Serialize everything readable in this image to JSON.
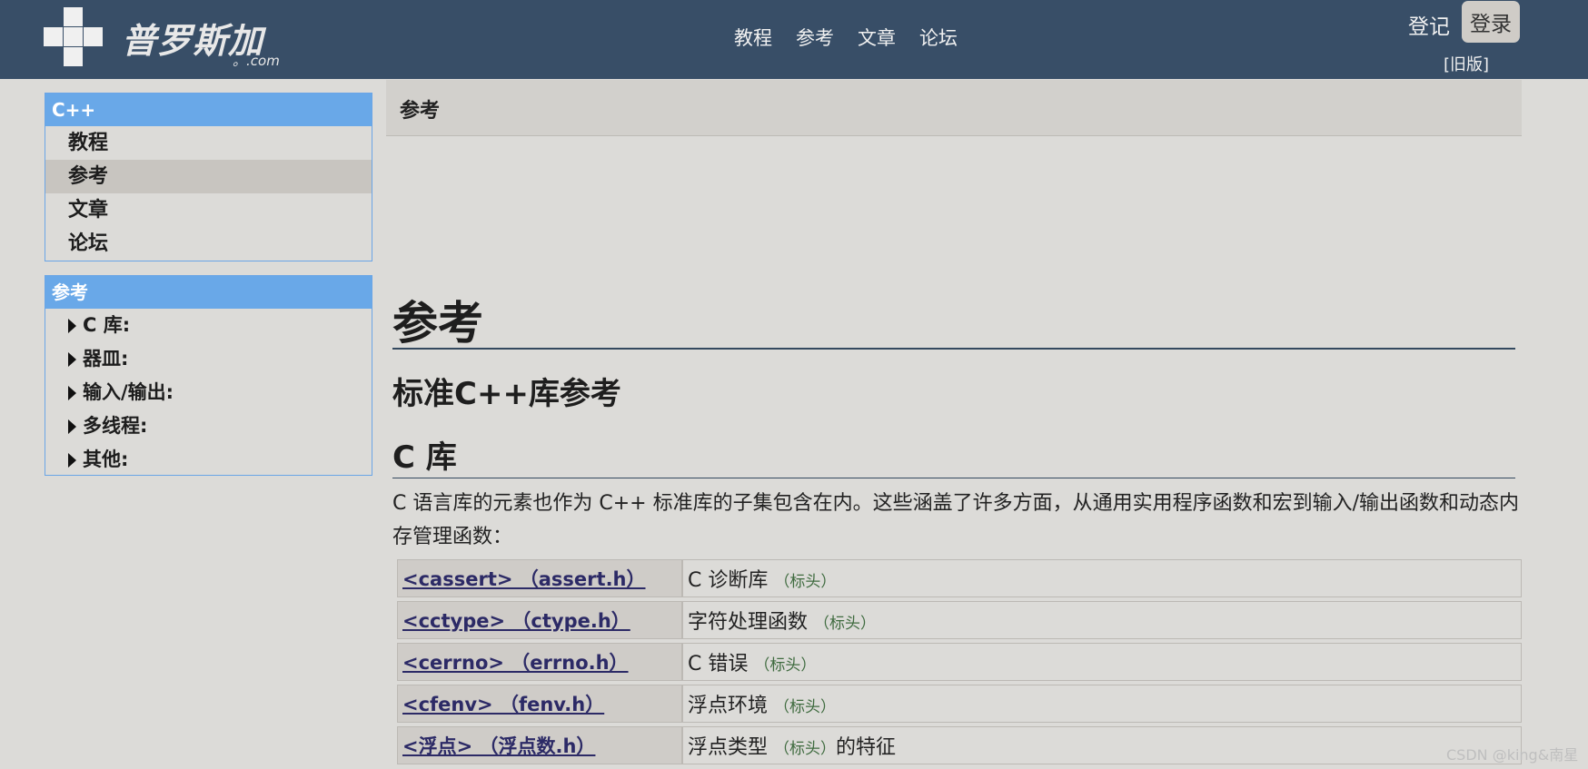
{
  "header": {
    "logo_text": "普罗斯加",
    "logo_domain": "。.com",
    "nav": [
      "教程",
      "参考",
      "文章",
      "论坛"
    ],
    "signup_label": "登记",
    "login_label": "登录",
    "old_version_label": "[旧版]"
  },
  "sidebar": {
    "main_box": {
      "title": "C++",
      "items": [
        "教程",
        "参考",
        "文章",
        "论坛"
      ],
      "selected_index": 1
    },
    "ref_box": {
      "title": "参考",
      "items": [
        "C 库:",
        "器皿:",
        "输入/输出:",
        "多线程:",
        "其他:"
      ]
    }
  },
  "main": {
    "breadcrumb": "参考",
    "title": "参考",
    "subtitle": "标准C++库参考",
    "section_title": "C 库",
    "intro": "C 语言库的元素也作为 C++ 标准库的子集包含在内。这些涵盖了许多方面，从通用实用程序函数和宏到输入/输出函数和动态内存管理函数：",
    "rows": [
      {
        "link": "<cassert> （assert.h）",
        "desc": "C 诊断库",
        "tag": "（标头）",
        "suffix": ""
      },
      {
        "link": "<cctype> （ctype.h）",
        "desc": "字符处理函数",
        "tag": "（标头）",
        "suffix": ""
      },
      {
        "link": "<cerrno> （errno.h）",
        "desc": "C 错误",
        "tag": "（标头）",
        "suffix": ""
      },
      {
        "link": "<cfenv> （fenv.h）",
        "desc": "浮点环境",
        "tag": "（标头）",
        "suffix": ""
      },
      {
        "link": "<浮点> （浮点数.h）",
        "desc": "浮点类型",
        "tag": "（标头）",
        "suffix": "的特征"
      }
    ]
  },
  "watermark": "CSDN @king&南星",
  "colors": {
    "header_bg": "#384e67",
    "sidebar_head": "#69a8e8",
    "page_bg": "#dcdbd8",
    "link": "#2c2a66"
  }
}
